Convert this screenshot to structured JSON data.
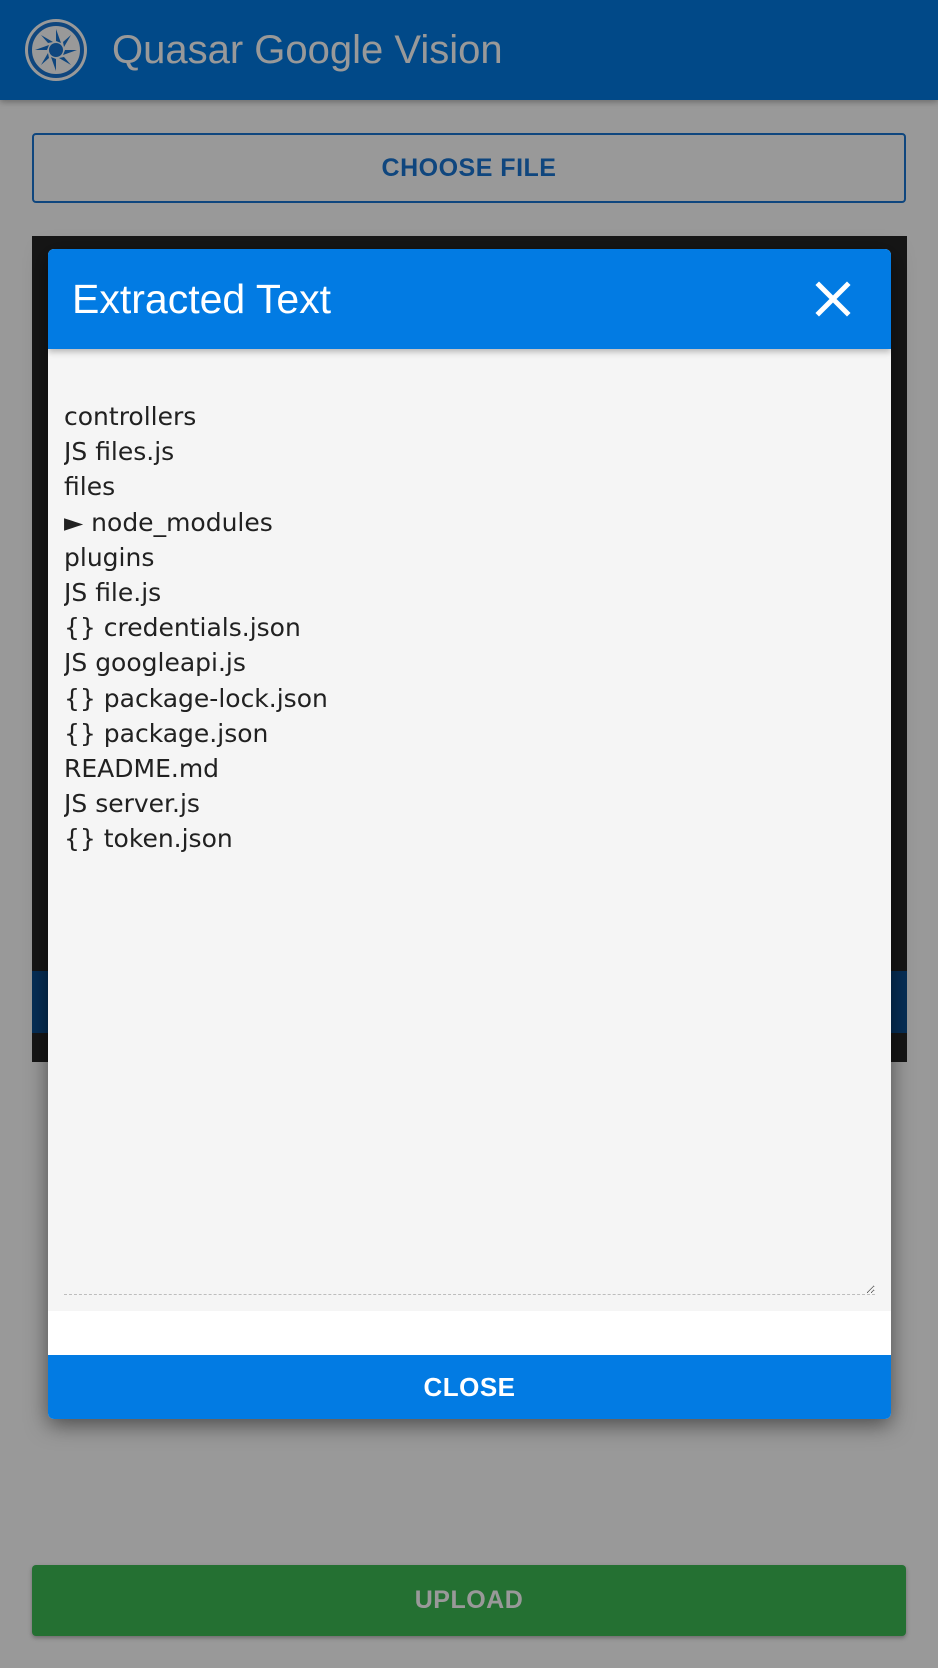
{
  "header": {
    "title": "Quasar Google Vision",
    "logo": "quasar-logo-icon"
  },
  "main": {
    "choose_file_label": "CHOOSE FILE",
    "upload_label": "UPLOAD"
  },
  "dialog": {
    "title": "Extracted Text",
    "close_icon": "close-icon",
    "extracted_text": "controllers\nJS files.js\nfiles\n► node_modules\nplugins\nJS file.js\n{} credentials.json\nJS googleapi.js\n{} package-lock.json\n{} package.json\nREADME.md\nJS server.js\n{} token.json",
    "close_button_label": "CLOSE"
  },
  "colors": {
    "primary": "#027be3",
    "positive": "#3dbb54",
    "outline": "#1976d2"
  }
}
